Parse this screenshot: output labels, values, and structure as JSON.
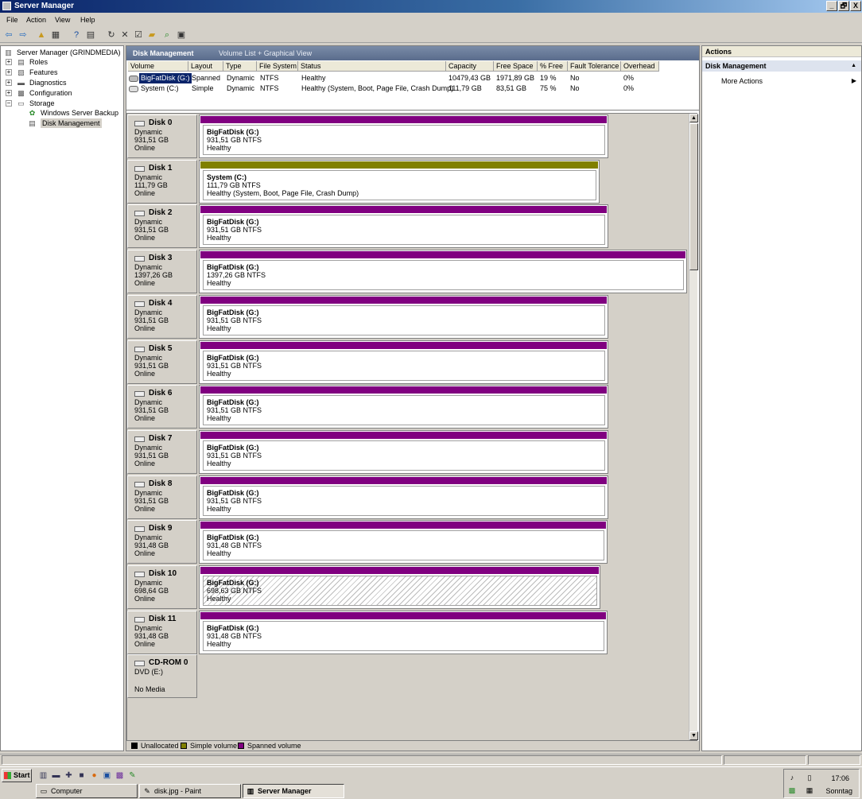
{
  "window": {
    "title": "Server Manager",
    "btn_min": "_",
    "btn_max": "🗗",
    "btn_close": "X"
  },
  "menu": [
    "File",
    "Action",
    "View",
    "Help"
  ],
  "tree": {
    "root": "Server Manager (GRINDMEDIA)",
    "roles": "Roles",
    "features": "Features",
    "diagnostics": "Diagnostics",
    "configuration": "Configuration",
    "storage": "Storage",
    "wsb": "Windows Server Backup",
    "dm": "Disk Management"
  },
  "dm_header": {
    "title": "Disk Management",
    "view": "Volume List + Graphical View"
  },
  "columns": [
    "Volume",
    "Layout",
    "Type",
    "File System",
    "Status",
    "Capacity",
    "Free Space",
    "% Free",
    "Fault Tolerance",
    "Overhead"
  ],
  "volumes": [
    {
      "name": "BigFatDisk (G:)",
      "layout": "Spanned",
      "type": "Dynamic",
      "fs": "NTFS",
      "status": "Healthy",
      "capacity": "10479,43 GB",
      "free": "1971,89 GB",
      "pct": "19 %",
      "fault": "No",
      "overhead": "0%"
    },
    {
      "name": "System (C:)",
      "layout": "Simple",
      "type": "Dynamic",
      "fs": "NTFS",
      "status": "Healthy (System, Boot, Page File, Crash Dump)",
      "capacity": "111,79 GB",
      "free": "83,51 GB",
      "pct": "75 %",
      "fault": "No",
      "overhead": "0%"
    }
  ],
  "disks": [
    {
      "name": "Disk 0",
      "type": "Dynamic",
      "size": "931,51 GB",
      "state": "Online",
      "vol": "BigFatDisk  (G:)",
      "vsize": "931,51 GB NTFS",
      "vstatus": "Healthy",
      "kind": "spanned",
      "frac": 0.839
    },
    {
      "name": "Disk 1",
      "type": "Dynamic",
      "size": "111,79 GB",
      "state": "Online",
      "vol": "System  (C:)",
      "vsize": "111,79 GB NTFS",
      "vstatus": "Healthy (System, Boot, Page File, Crash Dump)",
      "kind": "simple",
      "frac": 0.821
    },
    {
      "name": "Disk 2",
      "type": "Dynamic",
      "size": "931,51 GB",
      "state": "Online",
      "vol": "BigFatDisk  (G:)",
      "vsize": "931,51 GB NTFS",
      "vstatus": "Healthy",
      "kind": "spanned",
      "frac": 0.839
    },
    {
      "name": "Disk 3",
      "type": "Dynamic",
      "size": "1397,26 GB",
      "state": "Online",
      "vol": "BigFatDisk  (G:)",
      "vsize": "1397,26 GB NTFS",
      "vstatus": "Healthy",
      "kind": "spanned",
      "frac": 1.0
    },
    {
      "name": "Disk 4",
      "type": "Dynamic",
      "size": "931,51 GB",
      "state": "Online",
      "vol": "BigFatDisk  (G:)",
      "vsize": "931,51 GB NTFS",
      "vstatus": "Healthy",
      "kind": "spanned",
      "frac": 0.839
    },
    {
      "name": "Disk 5",
      "type": "Dynamic",
      "size": "931,51 GB",
      "state": "Online",
      "vol": "BigFatDisk  (G:)",
      "vsize": "931,51 GB NTFS",
      "vstatus": "Healthy",
      "kind": "spanned",
      "frac": 0.839
    },
    {
      "name": "Disk 6",
      "type": "Dynamic",
      "size": "931,51 GB",
      "state": "Online",
      "vol": "BigFatDisk  (G:)",
      "vsize": "931,51 GB NTFS",
      "vstatus": "Healthy",
      "kind": "spanned",
      "frac": 0.839
    },
    {
      "name": "Disk 7",
      "type": "Dynamic",
      "size": "931,51 GB",
      "state": "Online",
      "vol": "BigFatDisk  (G:)",
      "vsize": "931,51 GB NTFS",
      "vstatus": "Healthy",
      "kind": "spanned",
      "frac": 0.839
    },
    {
      "name": "Disk 8",
      "type": "Dynamic",
      "size": "931,51 GB",
      "state": "Online",
      "vol": "BigFatDisk  (G:)",
      "vsize": "931,51 GB NTFS",
      "vstatus": "Healthy",
      "kind": "spanned",
      "frac": 0.839
    },
    {
      "name": "Disk 9",
      "type": "Dynamic",
      "size": "931,48 GB",
      "state": "Online",
      "vol": "BigFatDisk  (G:)",
      "vsize": "931,48 GB NTFS",
      "vstatus": "Healthy",
      "kind": "spanned",
      "frac": 0.837
    },
    {
      "name": "Disk 10",
      "type": "Dynamic",
      "size": "698,64 GB",
      "state": "Online",
      "vol": "BigFatDisk  (G:)",
      "vsize": "698,63 GB NTFS",
      "vstatus": "Healthy",
      "kind": "hatched",
      "frac": 0.822
    },
    {
      "name": "Disk 11",
      "type": "Dynamic",
      "size": "931,48 GB",
      "state": "Online",
      "vol": "BigFatDisk  (G:)",
      "vsize": "931,48 GB NTFS",
      "vstatus": "Healthy",
      "kind": "spanned",
      "frac": 0.837
    }
  ],
  "cdrom": {
    "name": "CD-ROM 0",
    "type": "DVD (E:)",
    "state": "No Media"
  },
  "legend": [
    "Unallocated",
    "Simple volume",
    "Spanned volume"
  ],
  "colors": {
    "spanned": "#800080",
    "simple": "#808000",
    "unallocated": "#000000"
  },
  "actions": {
    "title": "Actions",
    "section": "Disk Management",
    "item": "More Actions"
  },
  "taskbar": {
    "start": "Start",
    "buttons": [
      "Computer",
      "disk.jpg - Paint",
      "Server Manager"
    ],
    "time": "17:06",
    "day": "Sonntag"
  }
}
